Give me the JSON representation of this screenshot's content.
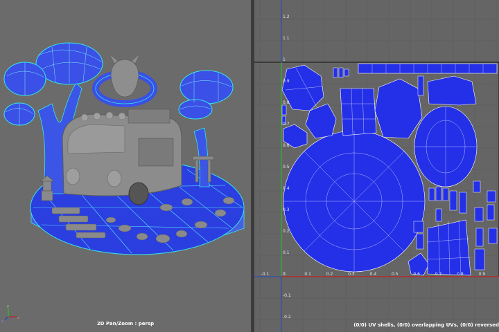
{
  "viewport": {
    "label": "2D Pan/Zoom : persp",
    "axis_labels": {
      "x": "x",
      "y": "y",
      "z": "z"
    }
  },
  "uv_editor": {
    "status_text": "(0/0) UV shells, (0/0) overlapping UVs, (0/0) reversed",
    "v_ticks": [
      "1.2",
      "1.1",
      "1",
      "0.9",
      "0.8",
      "0.7",
      "0.6",
      "0.5",
      "0.4",
      "0.3",
      "0.2",
      "0.1",
      "0",
      "-0.1",
      "-0.2"
    ],
    "u_ticks": [
      "-0.1",
      "0",
      "0.1",
      "0.2",
      "0.3",
      "0.4",
      "0.5",
      "0.6",
      "0.7",
      "0.8",
      "0.9"
    ]
  },
  "colors": {
    "viewport_bg": "#6b6b6b",
    "uv_bg": "#656565",
    "uv_shell_fill": "#2430e8",
    "wire": "#36e8e8",
    "uv_edge": "#ffffff",
    "axis_red": "#c81e1e",
    "axis_green": "#1ec81e",
    "axis_blue": "#1e46c8"
  }
}
